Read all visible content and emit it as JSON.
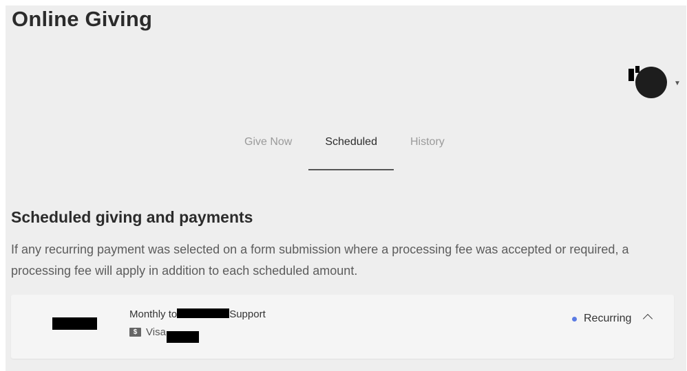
{
  "header": {
    "title": "Online Giving"
  },
  "tabs": [
    {
      "label": "Give Now",
      "active": false
    },
    {
      "label": "Scheduled",
      "active": true
    },
    {
      "label": "History",
      "active": false
    }
  ],
  "section": {
    "title": "Scheduled giving and payments",
    "description": "If any recurring payment was selected on a form submission where a processing fee was accepted or required, a processing fee will apply in addition to each scheduled amount."
  },
  "schedule": {
    "prefix": "Monthly to",
    "suffix": "Support",
    "payment_icon": "$",
    "payment_method": "Visa",
    "status": "Recurring",
    "status_color": "#5b7be3"
  }
}
